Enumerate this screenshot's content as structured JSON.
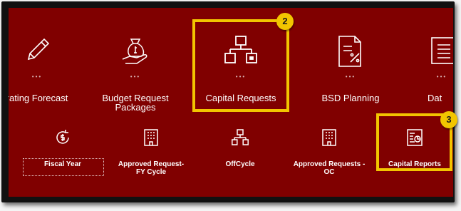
{
  "springboard_top": [
    {
      "label": "rating Forecast",
      "icon": "pencil-icon"
    },
    {
      "label": "Budget Request\nPackages",
      "icon": "money-bag-hand-icon"
    },
    {
      "label": "Capital Requests",
      "icon": "hierarchy-icon"
    },
    {
      "label": "BSD Planning",
      "icon": "document-percent-icon"
    },
    {
      "label": "Dat",
      "icon": "data-list-icon"
    }
  ],
  "springboard_more_indicator": "•••",
  "springboard_bottom": [
    {
      "label": "Fiscal Year",
      "icon": "refresh-dollar-icon"
    },
    {
      "label": "Approved Request-\nFY Cycle",
      "icon": "building-icon"
    },
    {
      "label": "OffCycle",
      "icon": "hierarchy-small-icon"
    },
    {
      "label": "Approved Requests -\nOC",
      "icon": "building-icon"
    },
    {
      "label": "Capital Reports",
      "icon": "report-chart-icon"
    }
  ],
  "callouts": [
    {
      "number": "2",
      "target": "Capital Requests"
    },
    {
      "number": "3",
      "target": "Capital Reports"
    }
  ],
  "colors": {
    "panel_background": "#800000",
    "callout_yellow": "#f2c500",
    "icon_white": "#ffffff"
  }
}
